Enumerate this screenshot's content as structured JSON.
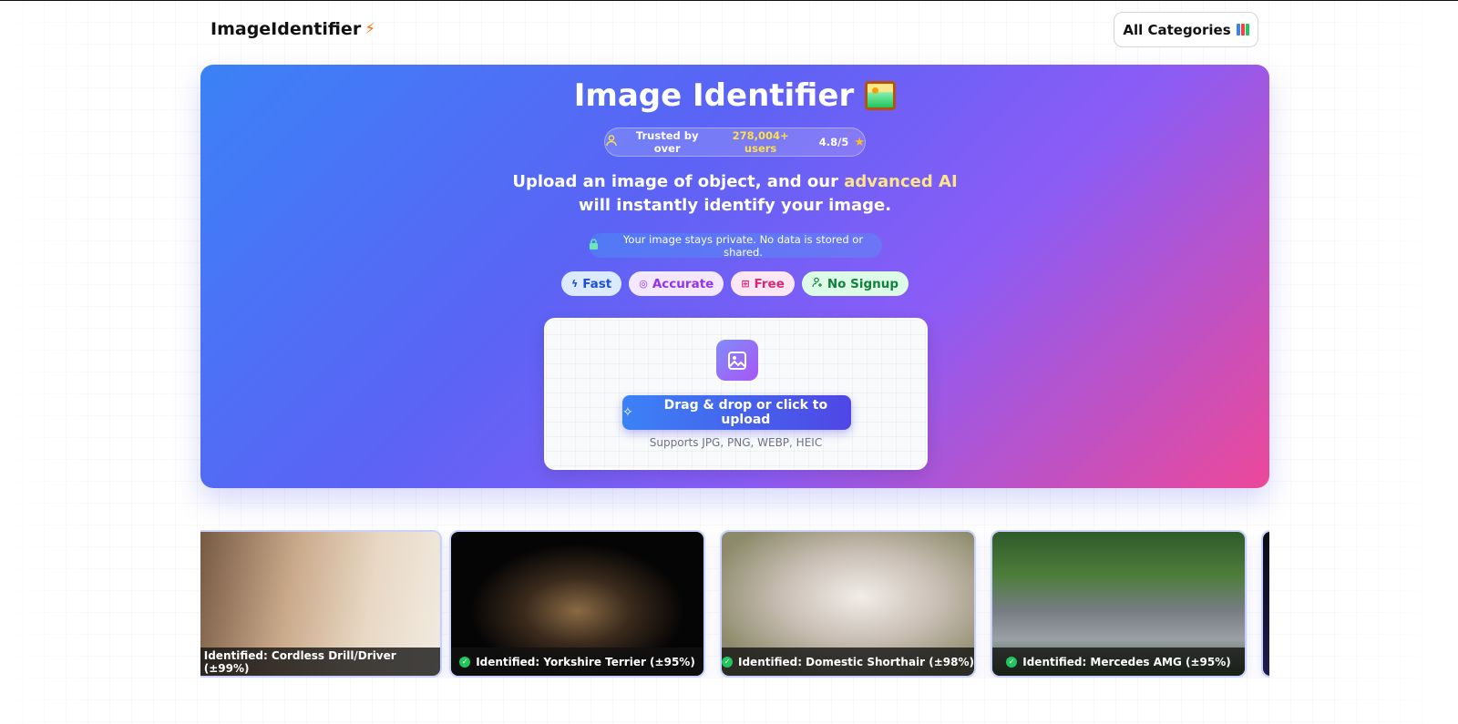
{
  "header": {
    "logo_text": "ImageIdentifier",
    "categories_button": "All Categories"
  },
  "hero": {
    "title": "Image Identifier",
    "trust_prefix": "Trusted by over",
    "trust_count": "278,004+ users",
    "rating": "4.8/5",
    "subtitle_part1": "Upload an image of object, and our",
    "subtitle_highlight": "advanced AI",
    "subtitle_part2": "will instantly identify your image.",
    "privacy_note": "Your image stays private. No data is stored or shared.",
    "chips": [
      {
        "label": "Fast",
        "icon": "bolt-icon"
      },
      {
        "label": "Accurate",
        "icon": "target-icon"
      },
      {
        "label": "Free",
        "icon": "gift-icon"
      },
      {
        "label": "No Signup",
        "icon": "user-plus-icon"
      }
    ]
  },
  "upload": {
    "button_label": "Drag & drop or click to upload",
    "supports_text": "Supports JPG, PNG, WEBP, HEIC"
  },
  "gallery": {
    "cards": [
      {
        "caption": "Identified: Cordless Drill/Driver (±99%)"
      },
      {
        "caption": "Identified: Yorkshire Terrier (±95%)"
      },
      {
        "caption": "Identified: Domestic Shorthair (±98%)"
      },
      {
        "caption": "Identified: Mercedes AMG (±95%)"
      }
    ]
  },
  "colors": {
    "hero_gradient_start": "#3b82f6",
    "hero_gradient_mid": "#8b5cf6",
    "hero_gradient_end": "#ec4899",
    "highlight": "#fde68a",
    "logo_bolt": "#f97316",
    "check": "#22c55e"
  }
}
